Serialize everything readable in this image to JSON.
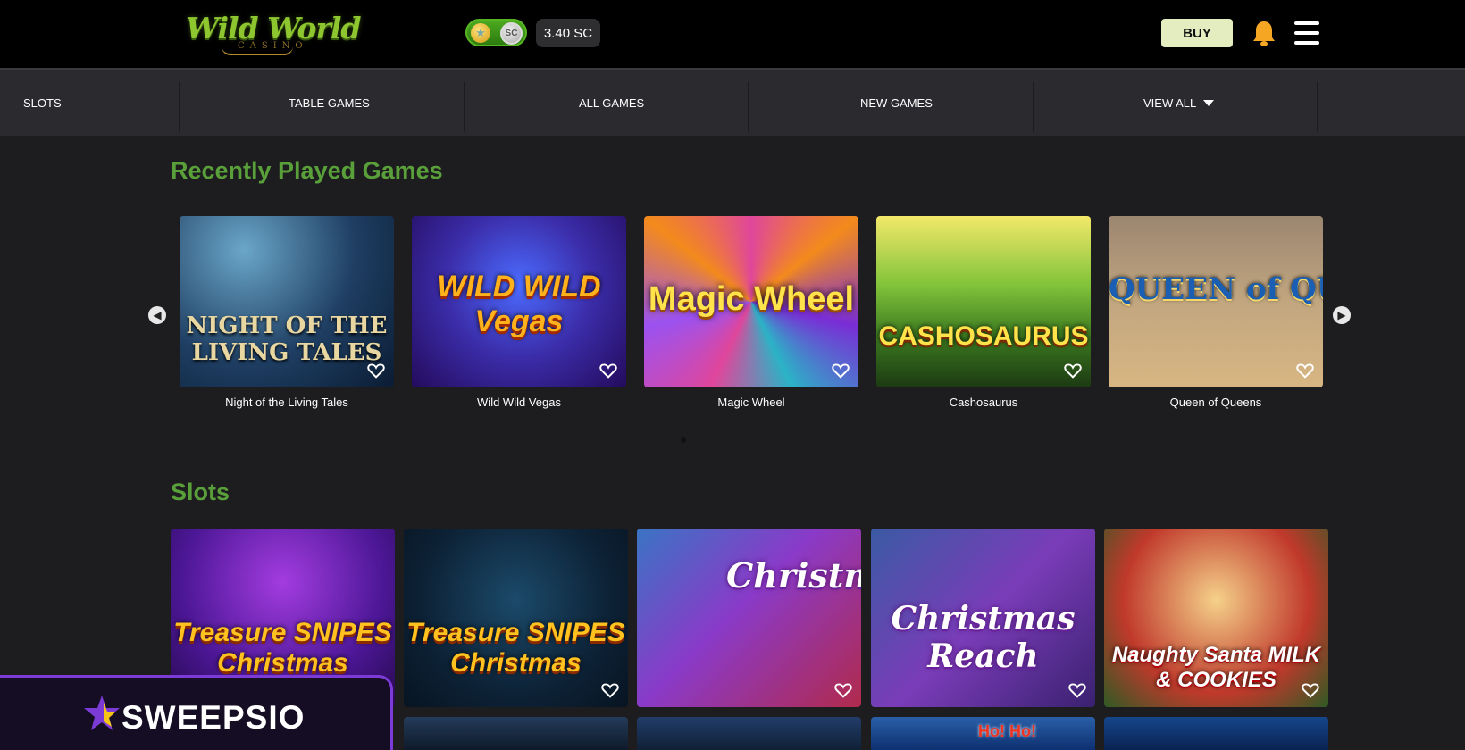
{
  "header": {
    "logo_main": "Wild World",
    "logo_sub": "CASINO",
    "toggle_sc_label": "SC",
    "balance": "3.40 SC",
    "buy_label": "BUY"
  },
  "nav": {
    "items": [
      "SLOTS",
      "TABLE GAMES",
      "ALL GAMES",
      "NEW GAMES",
      "VIEW ALL"
    ]
  },
  "recent": {
    "title": "Recently Played Games",
    "games": [
      {
        "name": "Night of the Living Tales",
        "art": "NIGHT OF THE LIVING TALES"
      },
      {
        "name": "Wild Wild Vegas",
        "art": "WILD WILD Vegas"
      },
      {
        "name": "Magic Wheel",
        "art": "Magic Wheel"
      },
      {
        "name": "Cashosaurus",
        "art": "CASHOSAURUS"
      },
      {
        "name": "Queen of Queens",
        "art": "QUEEN of QUEENS"
      }
    ]
  },
  "slots": {
    "title": "Slots",
    "games": [
      {
        "art": "Treasure SNIPES Christmas"
      },
      {
        "art": "Treasure SNIPES Christmas"
      },
      {
        "art": "Christmas Reach"
      },
      {
        "art": "Christmas Reach"
      },
      {
        "art": "Naughty Santa MILK & COOKIES"
      }
    ],
    "partial_art_label": "Ho! Ho!"
  },
  "badge": {
    "text": "SWEEPSIO"
  },
  "colors": {
    "accent_green": "#5aa03a",
    "buy_bg": "#e4edc0",
    "bell": "#f5a623",
    "badge_border": "#7c3ad6"
  },
  "icons": [
    "gold-coin-icon",
    "sc-coin-icon",
    "bell-icon",
    "hamburger-menu-icon",
    "chevron-down-icon",
    "arrow-left-icon",
    "arrow-right-icon",
    "heart-icon",
    "sweepsio-star-icon"
  ]
}
